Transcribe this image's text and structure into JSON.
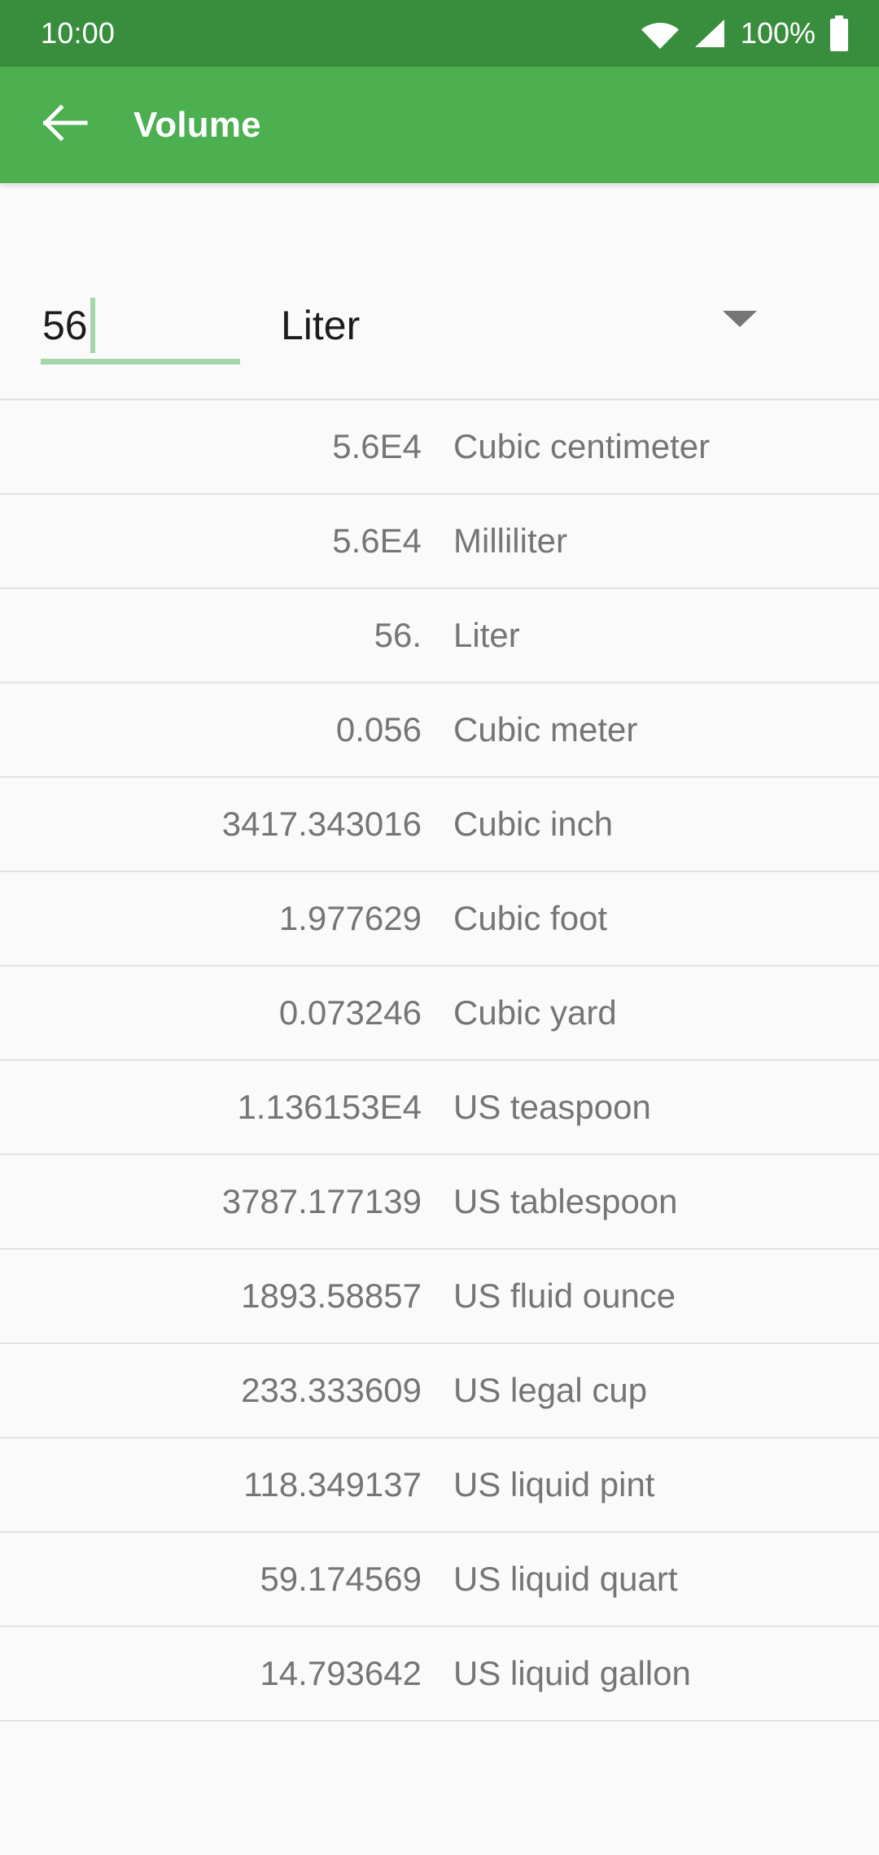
{
  "status_bar": {
    "time": "10:00",
    "battery_percent": "100%",
    "icons": [
      "wifi-icon",
      "cellular-signal-icon",
      "battery-icon"
    ],
    "background_color": "#388e3c"
  },
  "app_bar": {
    "back_label": "back-arrow-icon",
    "title": "Volume",
    "background_color": "#4caf50"
  },
  "converter": {
    "input_value": "56",
    "input_placeholder": "",
    "selected_unit": "Liter",
    "dropdown_icon": "chevron-down-icon",
    "accent_color": "#a5d6a7"
  },
  "results": {
    "column_headers": [
      "value",
      "unit"
    ],
    "rows": [
      {
        "value": "5.6E4",
        "unit": "Cubic centimeter"
      },
      {
        "value": "5.6E4",
        "unit": "Milliliter"
      },
      {
        "value": "56.",
        "unit": "Liter"
      },
      {
        "value": "0.056",
        "unit": "Cubic meter"
      },
      {
        "value": "3417.343016",
        "unit": "Cubic inch"
      },
      {
        "value": "1.977629",
        "unit": "Cubic foot"
      },
      {
        "value": "0.073246",
        "unit": "Cubic yard"
      },
      {
        "value": "1.136153E4",
        "unit": "US teaspoon"
      },
      {
        "value": "3787.177139",
        "unit": "US tablespoon"
      },
      {
        "value": "1893.58857",
        "unit": "US fluid ounce"
      },
      {
        "value": "233.333609",
        "unit": "US legal cup"
      },
      {
        "value": "118.349137",
        "unit": "US liquid pint"
      },
      {
        "value": "59.174569",
        "unit": "US liquid quart"
      },
      {
        "value": "14.793642",
        "unit": "US liquid gallon"
      }
    ]
  }
}
